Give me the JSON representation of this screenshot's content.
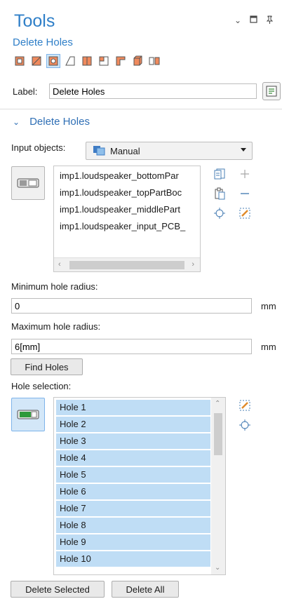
{
  "panel": {
    "title": "Tools",
    "subtitle": "Delete Holes"
  },
  "window_controls": [
    "chevron-down-icon",
    "maximize-icon",
    "pin-icon"
  ],
  "toolbar": [
    "delete-holes-tool-1",
    "fill-face-tool",
    "delete-holes-tool-active",
    "fill-surface-tool",
    "split-tool",
    "merge-tool",
    "cut-corner-tool",
    "solid-box-tool",
    "detach-tool"
  ],
  "label_field": {
    "label": "Label:",
    "value": "Delete Holes"
  },
  "section": {
    "title": "Delete Holes"
  },
  "input_objects": {
    "label": "Input objects:",
    "selected": "Manual"
  },
  "objects": [
    "imp1.loudspeaker_bottomPar",
    "imp1.loudspeaker_topPartBoc",
    "imp1.loudspeaker_middlePart",
    "imp1.loudspeaker_input_PCB_"
  ],
  "min_radius": {
    "label": "Minimum hole radius:",
    "value": "0",
    "unit": "mm"
  },
  "max_radius": {
    "label": "Maximum hole radius:",
    "value": "6[mm]",
    "unit": "mm"
  },
  "find_button": "Find Holes",
  "hole_selection": {
    "label": "Hole selection:"
  },
  "holes": [
    "Hole 1",
    "Hole 2",
    "Hole 3",
    "Hole 4",
    "Hole 5",
    "Hole 6",
    "Hole 7",
    "Hole 8",
    "Hole 9",
    "Hole 10"
  ],
  "buttons": {
    "delete_selected": "Delete Selected",
    "delete_all": "Delete All"
  },
  "colors": {
    "accent": "#2f7fc8",
    "selection": "#bfddf5"
  }
}
